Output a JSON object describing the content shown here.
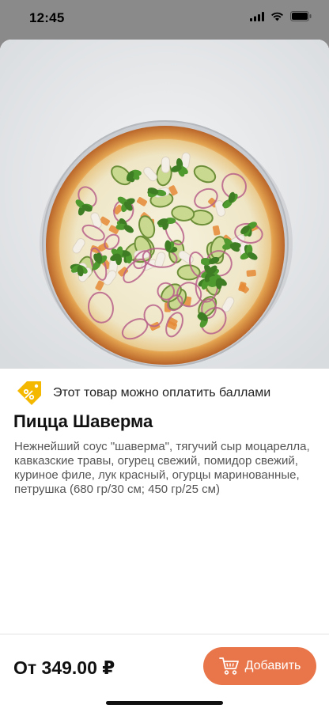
{
  "status_bar": {
    "time": "12:45",
    "icons": [
      "signal-icon",
      "wifi-icon",
      "battery-icon"
    ]
  },
  "product": {
    "image_alt": "pizza-photo",
    "points_text": "Этот товар можно оплатить баллами",
    "points_icon": "discount-tag-icon",
    "title": "Пицца Шаверма",
    "description": "Нежнейший соус  \"шаверма\", тягучий сыр моцарелла, кавказские травы, огурец свежий, помидор свежий, куриное филе, лук красный, огурцы маринованные, петрушка (680 гр/30 см; 450 гр/25 см)"
  },
  "footer": {
    "price": "От 349.00 ₽",
    "add_button_label": "Добавить",
    "cart_icon": "cart-icon"
  },
  "colors": {
    "accent": "#e8764a",
    "tag": "#f5b800"
  }
}
